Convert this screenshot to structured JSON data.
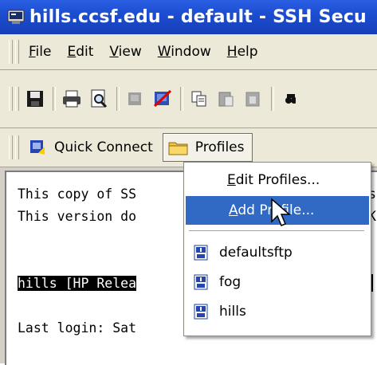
{
  "window": {
    "title": "hills.ccsf.edu - default - SSH Secu"
  },
  "menubar": {
    "items": [
      {
        "label": "File",
        "mnemonic": "F",
        "rest": "ile"
      },
      {
        "label": "Edit",
        "mnemonic": "E",
        "rest": "dit"
      },
      {
        "label": "View",
        "mnemonic": "V",
        "rest": "iew"
      },
      {
        "label": "Window",
        "mnemonic": "W",
        "rest": "indow"
      },
      {
        "label": "Help",
        "mnemonic": "H",
        "rest": "elp"
      }
    ]
  },
  "toolbar": {
    "icons": [
      "save-icon",
      "print-icon",
      "print-preview-icon",
      "disabled-connect-icon",
      "disconnect-icon",
      "copy-icon",
      "paste-icon",
      "paste-disabled-icon",
      "find-icon"
    ]
  },
  "connectbar": {
    "quick_connect_label": "Quick Connect",
    "profiles_label": "Profiles"
  },
  "terminal": {
    "lines": [
      "This copy of SS",
      "This version do",
      "hills [HP Relea",
      "Last login: Sat"
    ],
    "right_fragments": [
      "s",
      "K"
    ]
  },
  "dropdown": {
    "edit_profiles": {
      "mnemonic": "E",
      "rest": "dit Profiles..."
    },
    "add_profile": {
      "mnemonic": "A",
      "rest": "dd Profile..."
    },
    "profiles": [
      "defaultsftp",
      "fog",
      "hills"
    ]
  },
  "colors": {
    "title_bar": "#1c4dd0",
    "menu_highlight": "#316ac5",
    "toolbar_bg": "#ece9d8"
  }
}
